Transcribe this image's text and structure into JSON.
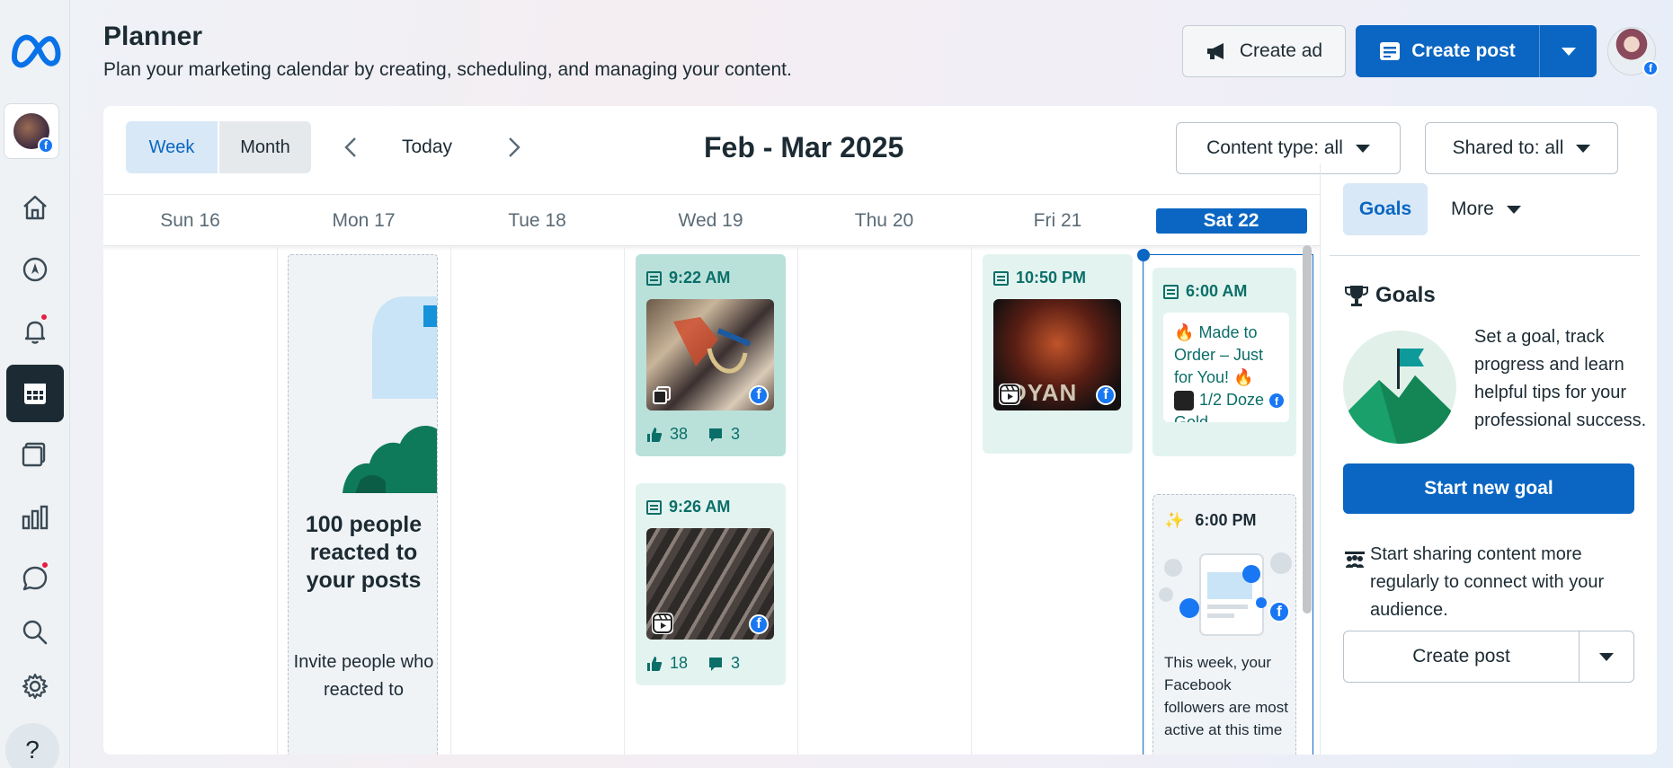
{
  "header": {
    "title": "Planner",
    "subtitle": "Plan your marketing calendar by creating, scheduling, and managing your content.",
    "create_ad_label": "Create ad",
    "create_post_label": "Create post"
  },
  "sidebar": {
    "items": [
      {
        "icon": "home-icon"
      },
      {
        "icon": "compass-icon"
      },
      {
        "icon": "bell-icon",
        "has_notification": true
      },
      {
        "icon": "calendar-icon",
        "active": true
      },
      {
        "icon": "content-library-icon"
      },
      {
        "icon": "insights-icon"
      },
      {
        "icon": "inbox-icon",
        "has_notification": true
      },
      {
        "icon": "search-icon"
      },
      {
        "icon": "settings-icon"
      }
    ],
    "help_label": "?"
  },
  "toolbar": {
    "view_week": "Week",
    "view_month": "Month",
    "today_label": "Today",
    "date_range": "Feb - Mar 2025",
    "content_type_filter": "Content type: all",
    "shared_to_filter": "Shared to: all"
  },
  "days": [
    "Sun 16",
    "Mon 17",
    "Tue 18",
    "Wed 19",
    "Thu 20",
    "Fri 21",
    "Sat 22"
  ],
  "selected_day": "Sat 22",
  "posts": {
    "wed_1": {
      "time": "9:22 AM",
      "likes": "38",
      "comments": "3",
      "media": "multi-photo"
    },
    "wed_2": {
      "time": "9:26 AM",
      "likes": "18",
      "comments": "3",
      "media": "reel"
    },
    "fri_1": {
      "time": "10:50 PM",
      "media": "reel",
      "thumb_text": "DYAN"
    },
    "sat_1": {
      "time": "6:00 AM",
      "caption_line1": "Made to Order – Just for You!",
      "caption_line2": "1/2 Doze",
      "caption_line3": "Gold"
    },
    "sat_2": {
      "time": "6:00 PM",
      "insight": "This week, your Facebook followers are most active at this time"
    }
  },
  "promo": {
    "headline": "100 people reacted to your posts",
    "body": "Invite people who reacted to"
  },
  "side_panel": {
    "tab_goals": "Goals",
    "tab_more": "More",
    "goals_heading": "Goals",
    "goals_description": "Set a goal, track progress and learn helpful tips for your professional success.",
    "start_goal_label": "Start new goal",
    "tip_text": "Start sharing content more regularly to connect with your audience.",
    "create_post_label": "Create post"
  },
  "colors": {
    "accent": "#0a66c2",
    "teal_text": "#0b6e68",
    "card_dark": "#b9e1da",
    "card_light": "#e3f4f0",
    "notification": "#e41e3f"
  }
}
